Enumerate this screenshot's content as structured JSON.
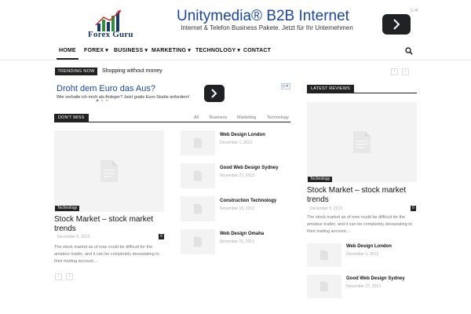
{
  "site": {
    "logo_text": "Forex Guru"
  },
  "top_ad": {
    "title": "Unitymedia® B2B Internet",
    "subtitle": "Internet & Telefon Business Pakete. Jetzt für Ihr Unternehmen sichern!",
    "badge": "▷✕"
  },
  "nav": {
    "items": [
      {
        "label": "HOME",
        "active": true,
        "dropdown": false
      },
      {
        "label": "FOREX",
        "dropdown": true
      },
      {
        "label": "BUSINESS",
        "dropdown": true
      },
      {
        "label": "MARKETING",
        "dropdown": true
      },
      {
        "label": "TECHNOLOGY",
        "dropdown": true
      },
      {
        "label": "CONTACT",
        "dropdown": false
      }
    ],
    "search_icon": "search-icon"
  },
  "trending": {
    "badge": "TRENDING NOW",
    "text": "Shopping without money",
    "prev": "‹",
    "next": "›"
  },
  "mid_ad": {
    "title": "Droht dem Euro das Aus?",
    "subtitle": "Wie verhalte ich mich als Anleger? Jetzt gratis Euro-Studie anfordern!",
    "badge": "▷✕"
  },
  "dont_miss": {
    "title": "DON'T MISS",
    "filters": [
      "All",
      "Business",
      "Marketing",
      "Technology"
    ],
    "featured": {
      "category": "Technology",
      "title": "Stock Market – stock market trends",
      "date": "December 5, 2013",
      "comments": "0",
      "excerpt": "The stock market as of now could be difficult for the amateur trader, and it can be completely devastating to their trading account...."
    },
    "list": [
      {
        "title": "Web Design London",
        "date": "December 1, 2013"
      },
      {
        "title": "Good Web Design Sydney",
        "date": "November 27, 2013"
      },
      {
        "title": "Construction Technology",
        "date": "November 19, 2013"
      },
      {
        "title": "Web Design Omaha",
        "date": "November 15, 2013"
      }
    ],
    "prev": "‹",
    "next": "›"
  },
  "latest_reviews": {
    "title": "LATEST REVIEWS",
    "featured": {
      "category": "Technology",
      "title": "Stock Market – stock market trends",
      "date": "December 5, 2013",
      "comments": "0",
      "excerpt": "The stock market as of now could be difficult for the amateur trader, and it can be completely devastating to their trading account...."
    },
    "list": [
      {
        "title": "Web Design London",
        "date": "December 1, 2013"
      },
      {
        "title": "Good Web Design Sydney",
        "date": "November 27, 2013"
      }
    ]
  },
  "colors": {
    "ad_blue": "#1a47a5",
    "dark": "#222222"
  }
}
